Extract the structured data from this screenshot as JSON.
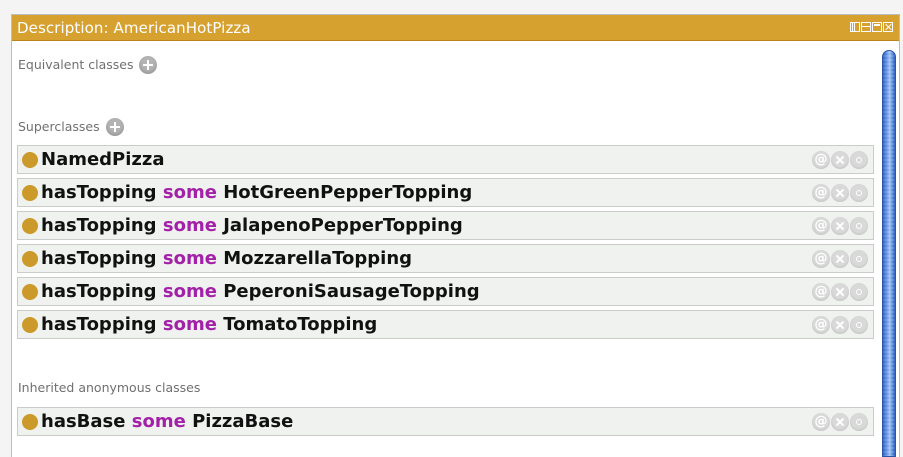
{
  "panel": {
    "title": "Description: AmericanHotPizza"
  },
  "sections": {
    "equivalent_label": "Equivalent classes",
    "superclasses_label": "Superclasses",
    "inherited_label": "Inherited anonymous classes"
  },
  "superclasses": [
    {
      "property": "NamedPizza",
      "keyword": "",
      "filler": ""
    },
    {
      "property": "hasTopping",
      "keyword": "some",
      "filler": "HotGreenPepperTopping"
    },
    {
      "property": "hasTopping",
      "keyword": "some",
      "filler": "JalapenoPepperTopping"
    },
    {
      "property": "hasTopping",
      "keyword": "some",
      "filler": "MozzarellaTopping"
    },
    {
      "property": "hasTopping",
      "keyword": "some",
      "filler": "PeperoniSausageTopping"
    },
    {
      "property": "hasTopping",
      "keyword": "some",
      "filler": "TomatoTopping"
    }
  ],
  "inherited": [
    {
      "property": "hasBase",
      "keyword": "some",
      "filler": "PizzaBase"
    }
  ],
  "row_action_icons": [
    "annotate-icon",
    "delete-icon",
    "edit-icon"
  ],
  "colors": {
    "title_bar": "#d6a12e",
    "class_dot": "#cc9a2a",
    "keyword": "#a321a8",
    "row_bg": "#eff2ee",
    "scrollbar": "#4f86dd"
  }
}
